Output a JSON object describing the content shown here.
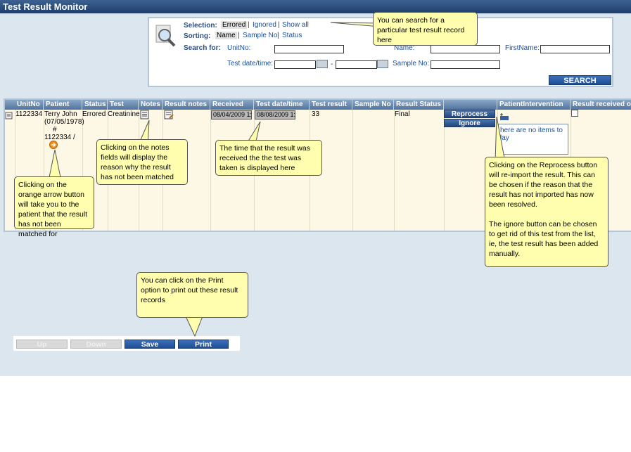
{
  "window": {
    "title": "Test Result Monitor"
  },
  "search": {
    "selection_label": "Selection:",
    "selection_options": [
      "Errored",
      "Ignored",
      "Show all"
    ],
    "sorting_label": "Sorting:",
    "sorting_options": [
      "Name",
      "Sample No",
      "Status"
    ],
    "search_for_label": "Search for:",
    "unitno_label": "UnitNo:",
    "name_label": "Name:",
    "firstname_label": "FirstName:",
    "test_datetime_label": "Test date/time:",
    "date_separator": "-",
    "sample_no_label": "Sample No:",
    "search_button": "SEARCH",
    "separator": "|"
  },
  "grid": {
    "columns": [
      "UnitNo",
      "Patient",
      "Status",
      "Test",
      "Notes",
      "Result notes",
      "Received",
      "Test date/time",
      "Test result",
      "Sample No",
      "Result Status",
      "",
      "PatientIntervention",
      "Result received o"
    ],
    "row": {
      "unitno": "1122334",
      "patient_name": "Terry John",
      "patient_dob": "(07/05/1978)",
      "patient_hash": "#",
      "patient_id": "1122334   /",
      "status": "Errored",
      "test": "Creatinine",
      "received": "08/04/2009 1:",
      "test_datetime": "08/08/2009 1:",
      "test_result": "33",
      "result_status": "Final",
      "reprocess_button": "Reprocess",
      "ignore_button": "Ignore",
      "intervention_empty": "here are no items to\nlay"
    }
  },
  "callouts": {
    "search": "You can search for a particular test result record here",
    "notes": "Clicking on the notes fields will display the reason why the result has not been matched",
    "time": "The time that the result was received the the test was taken is displayed here",
    "arrow": "Clicking on the orange arrow button will take you to the patient that the result has not been matched for",
    "reprocess": "Clicking on the Reprocess button will re-import the result. This can be chosen if the reason that the result has not imported has now been resolved.\n\nThe ignore button can be chosen to get rid of this test from the list, ie, the test result has been added manually.",
    "print": "You can click on the Print option to print out these result records"
  },
  "bottom": {
    "up_button": "Up",
    "down_button": "Down",
    "save_button": "Save",
    "print_button": "Print"
  },
  "colors": {
    "titlebar": "#2a4a78",
    "callout_bg": "#fefeae",
    "grid_bg": "#fdf8e6",
    "header_bg": "#6b8bb4"
  },
  "icons": [
    "search-magnifier-icon",
    "calendar-icon",
    "notes-icon",
    "result-notes-icon",
    "orange-arrow-icon",
    "row-document-icon",
    "intervention-icon"
  ]
}
